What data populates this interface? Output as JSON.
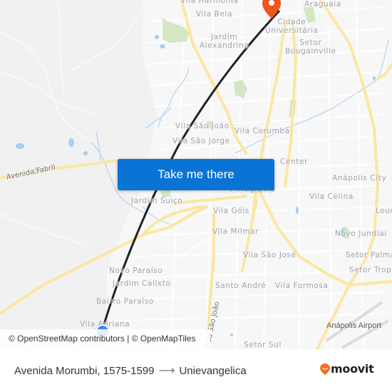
{
  "map": {
    "place_labels": [
      {
        "text": "Vila Harmonia"
      },
      {
        "text": "Vila Bela"
      },
      {
        "text": "Araguaia"
      },
      {
        "text": "Cidade\nUniversitária"
      },
      {
        "text": "Jardim\nAlexandrina"
      },
      {
        "text": "Setor\nBougainville"
      },
      {
        "text": "Vila São João"
      },
      {
        "text": "Vila Corumbá"
      },
      {
        "text": "Vila São Jorge"
      },
      {
        "text": "Center"
      },
      {
        "text": "Anápolis City"
      },
      {
        "text": "Vila Celina"
      },
      {
        "text": "Lour"
      },
      {
        "text": "Jardim Suiço"
      },
      {
        "text": "Vila Góis"
      },
      {
        "text": "Vila Milmar"
      },
      {
        "text": "Novo Jundiaí"
      },
      {
        "text": "Setor Palma"
      },
      {
        "text": "Setor Tropi"
      },
      {
        "text": "Vila São José"
      },
      {
        "text": "Novo Paraíso"
      },
      {
        "text": "Jardim Calixto"
      },
      {
        "text": "Santo André"
      },
      {
        "text": "Vila Formosa"
      },
      {
        "text": "Bairro Paraíso"
      },
      {
        "text": "Vila Adriana"
      },
      {
        "text": "Setor Sul"
      }
    ],
    "city_label": "Anápolis",
    "road_labels": {
      "avenida_fabril": "Avenida Fabril",
      "rua_sao_joao": "Rua São João"
    },
    "airport_label": "Anápolis Airport",
    "colors": {
      "background": "#f1f1f1",
      "major_road": "#fbe7a1",
      "minor_road": "#ffffff",
      "water": "#a7cdf2",
      "park": "#d4e6c3",
      "route_line": "#222222",
      "origin_marker": "#4285f4",
      "destination_marker": "#f0541e"
    }
  },
  "cta_button": {
    "label": "Take me there",
    "color": "#0a73d6"
  },
  "attribution": {
    "osm": "© OpenStreetMap contributors",
    "separator": " | ",
    "omt": "© OpenMapTiles"
  },
  "footer": {
    "origin": "Avenida Morumbi, 1575-1599",
    "arrow": "⟶",
    "destination": "Unievangelica",
    "brand": "moovit",
    "brand_color": "#f37021"
  }
}
